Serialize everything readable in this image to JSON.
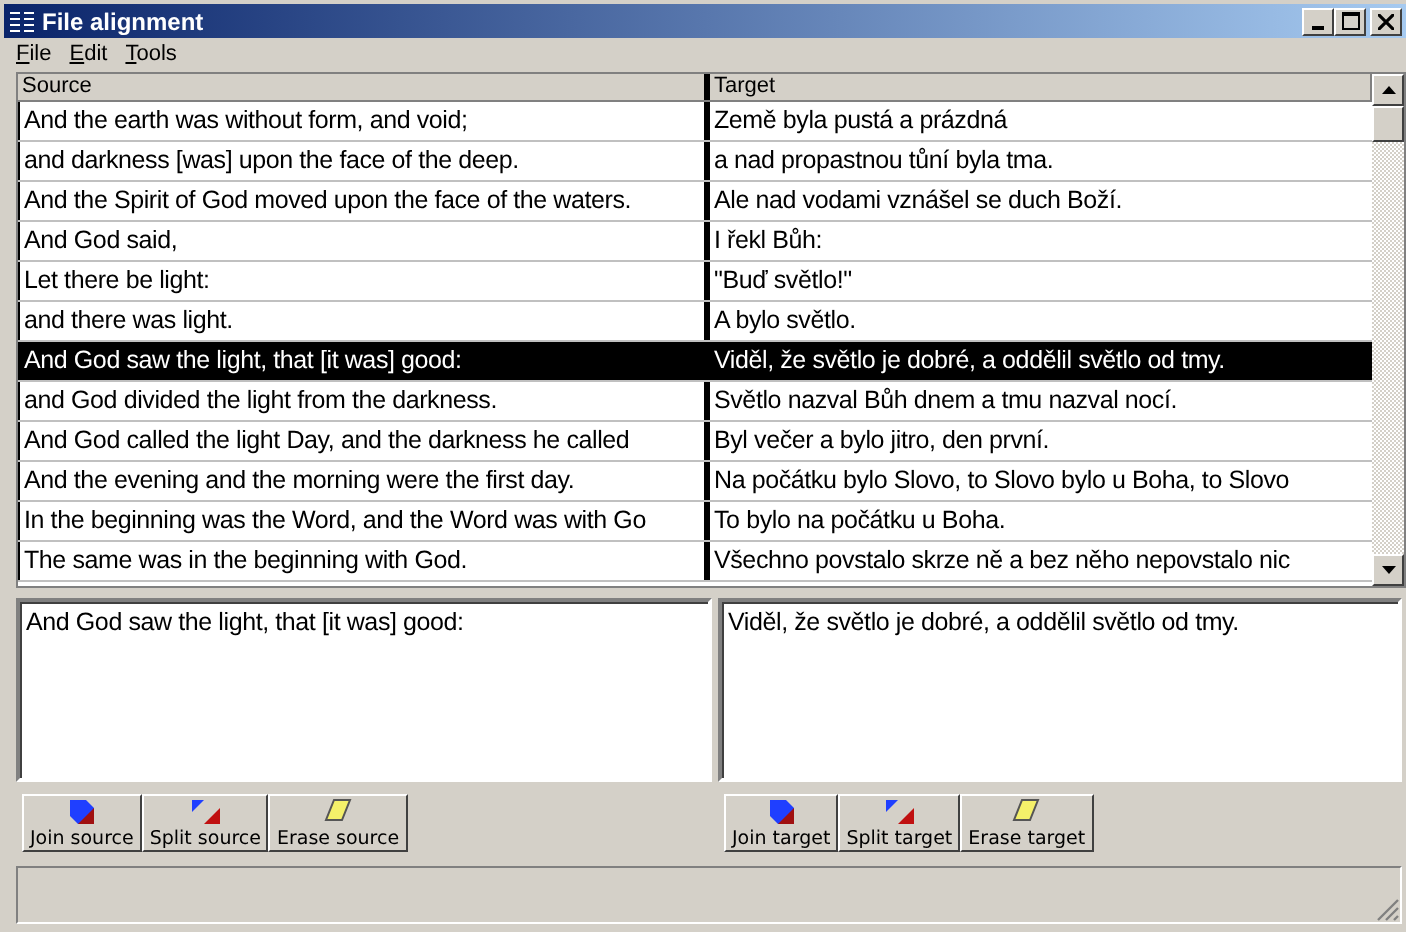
{
  "window": {
    "title": "File alignment"
  },
  "menu": [
    "File",
    "Edit",
    "Tools"
  ],
  "table": {
    "columns": [
      "Source",
      "Target"
    ],
    "rows": [
      {
        "source": "And the earth was without form, and void;",
        "target": "Země byla pustá a prázdná",
        "selected": false
      },
      {
        "source": "and darkness [was] upon the face of the deep.",
        "target": "a nad propastnou tůní byla tma.",
        "selected": false
      },
      {
        "source": "And the Spirit of God moved upon the face of the waters.",
        "target": "Ale nad vodami vznášel se duch Boží.",
        "selected": false
      },
      {
        "source": "And God said,",
        "target": "I řekl Bůh:",
        "selected": false
      },
      {
        "source": "Let there be light:",
        "target": "\"Buď světlo!\"",
        "selected": false
      },
      {
        "source": "and there was light.",
        "target": "A bylo světlo.",
        "selected": false
      },
      {
        "source": "And God saw the light, that [it was] good:",
        "target": "Viděl, že světlo je dobré, a oddělil světlo od tmy.",
        "selected": true
      },
      {
        "source": "and God divided the light from the darkness.",
        "target": "Světlo nazval Bůh dnem a tmu nazval nocí.",
        "selected": false
      },
      {
        "source": "And God called the light Day, and the darkness he called",
        "target": "Byl večer a bylo jitro, den první.",
        "selected": false
      },
      {
        "source": "And the evening and the morning were the first day.",
        "target": "Na počátku bylo Slovo, to Slovo bylo u Boha, to Slovo",
        "selected": false
      },
      {
        "source": "In the beginning was the Word, and the Word was with Go",
        "target": "To bylo na počátku u Boha.",
        "selected": false
      },
      {
        "source": "The same was in the beginning with God.",
        "target": "Všechno povstalo skrze ně a bez něho nepovstalo nic",
        "selected": false
      }
    ]
  },
  "source_detail": "And God saw the light, that [it was] good:",
  "target_detail": "Viděl, že světlo je dobré, a oddělil světlo od tmy.",
  "source_buttons": [
    {
      "label": "Join source",
      "kind": "join"
    },
    {
      "label": "Split source",
      "kind": "split"
    },
    {
      "label": "Erase source",
      "kind": "erase"
    }
  ],
  "target_buttons": [
    {
      "label": "Join target",
      "kind": "join"
    },
    {
      "label": "Split target",
      "kind": "split"
    },
    {
      "label": "Erase target",
      "kind": "erase"
    }
  ]
}
